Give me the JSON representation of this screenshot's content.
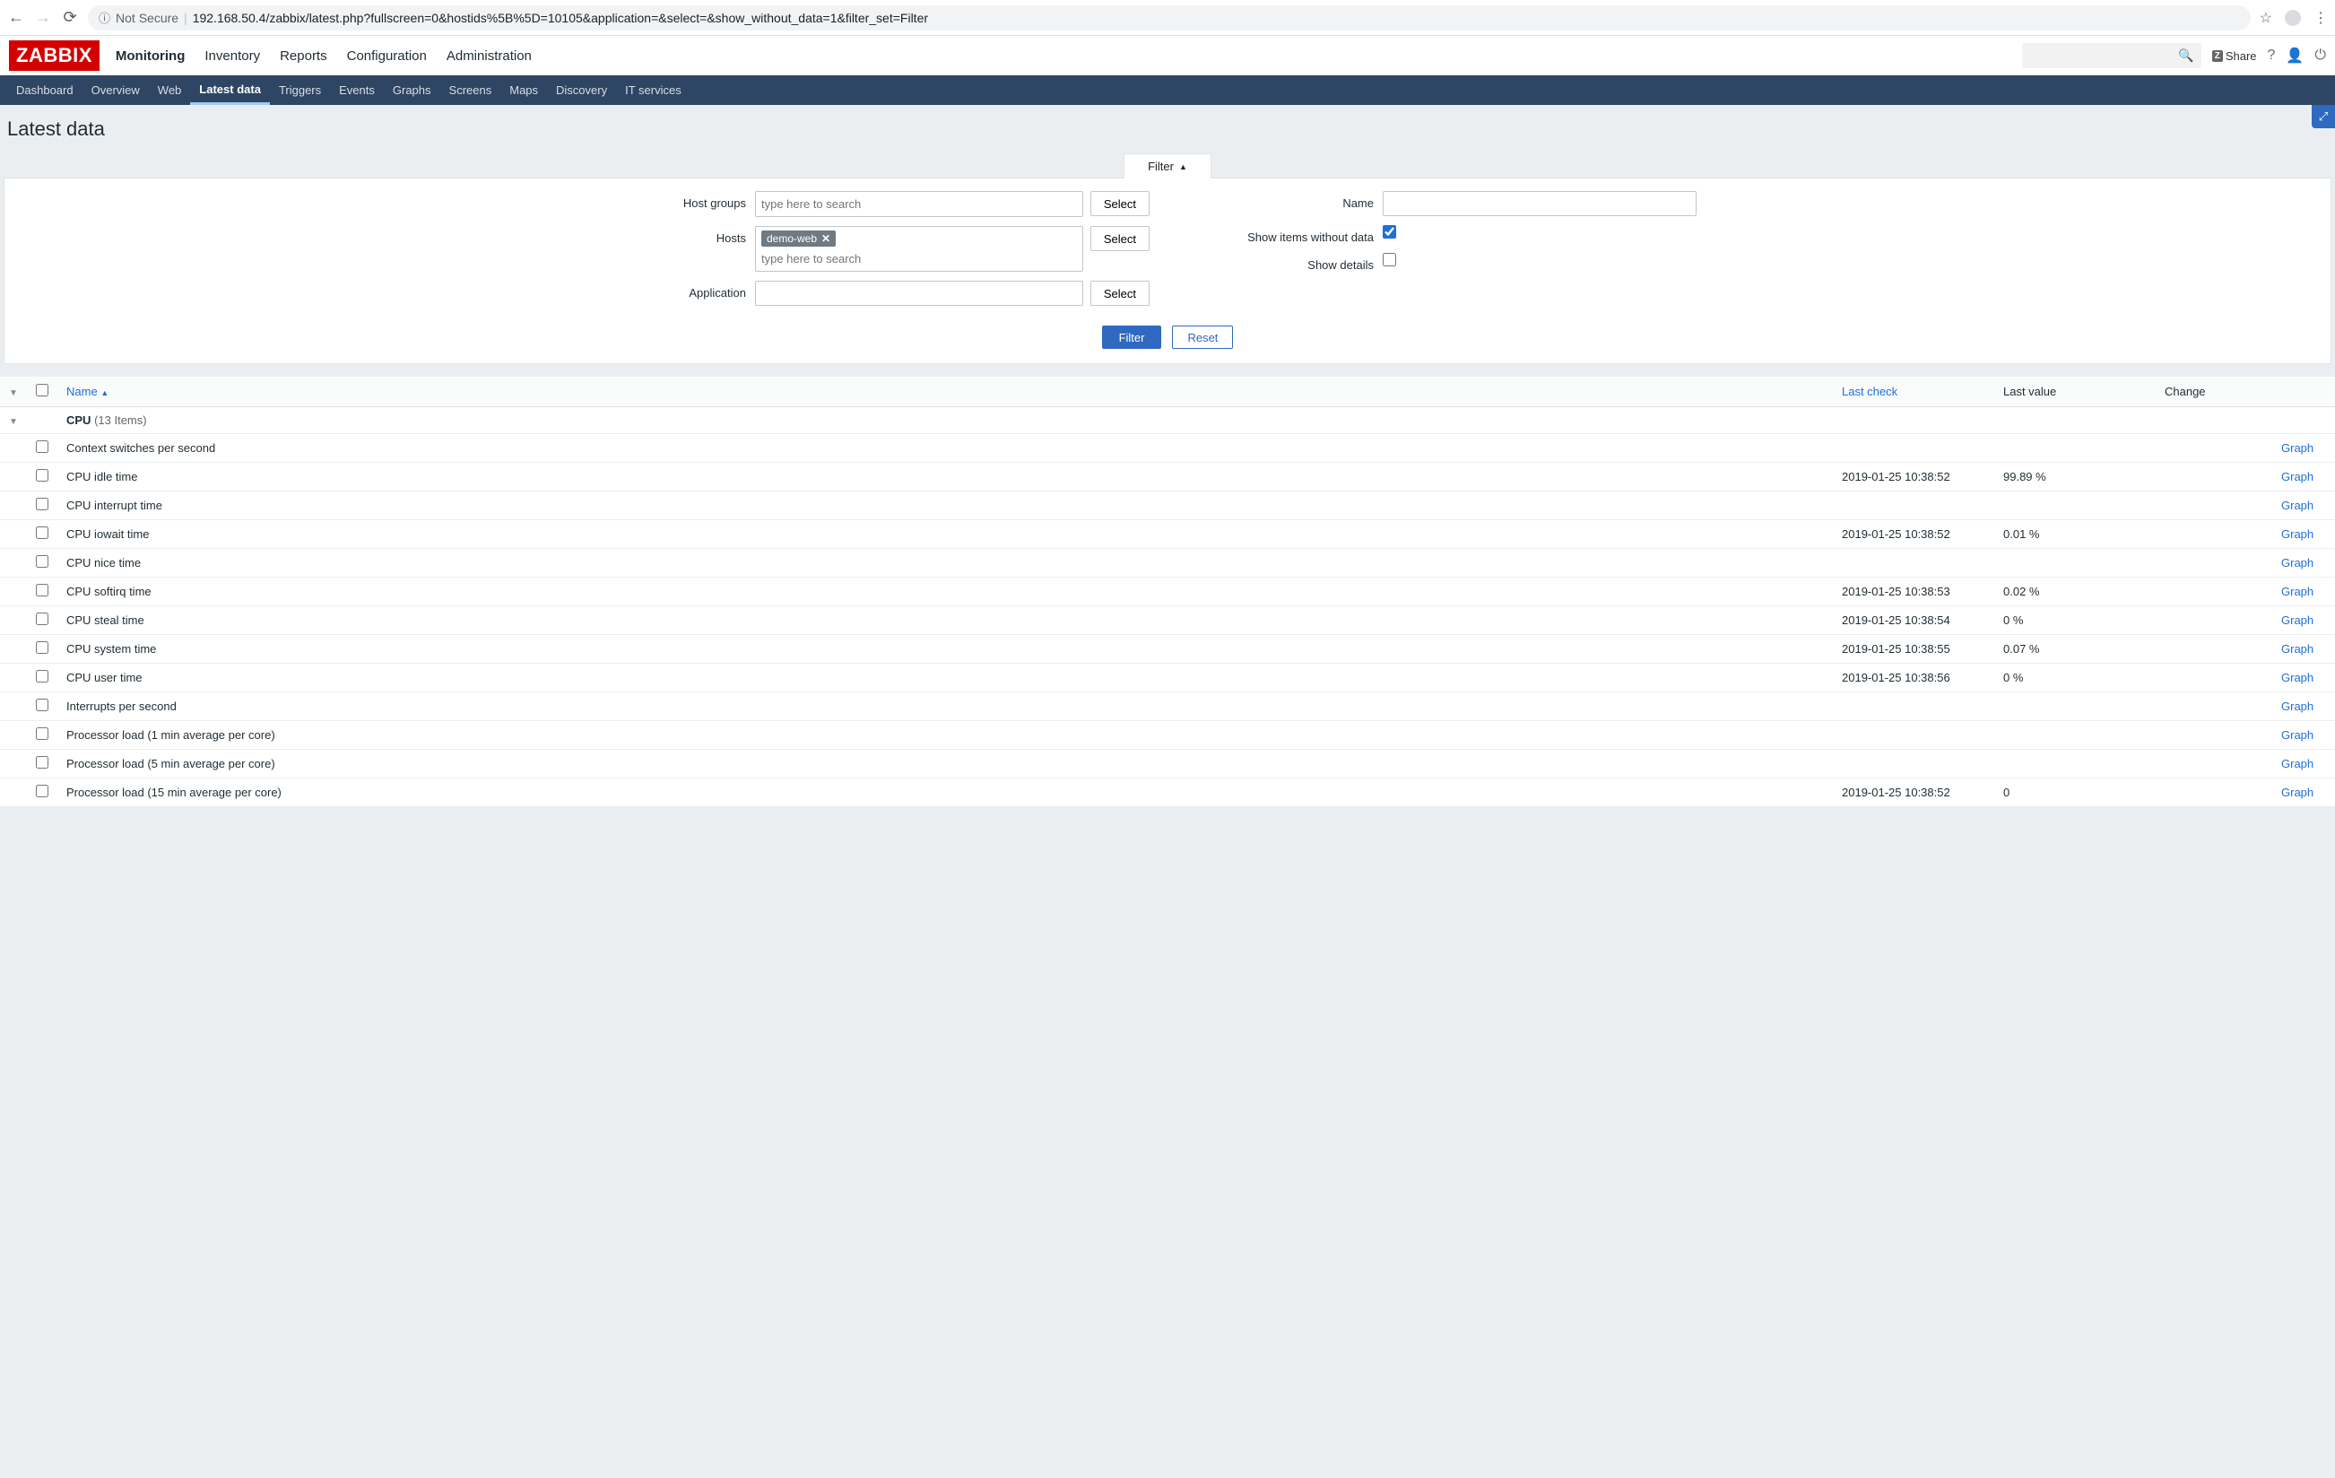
{
  "browser": {
    "not_secure": "Not Secure",
    "url": "192.168.50.4/zabbix/latest.php?fullscreen=0&hostids%5B%5D=10105&application=&select=&show_without_data=1&filter_set=Filter"
  },
  "brand": {
    "logo_text": "ZABBIX",
    "share_label": "Share"
  },
  "main_nav": [
    "Monitoring",
    "Inventory",
    "Reports",
    "Configuration",
    "Administration"
  ],
  "main_nav_active": 0,
  "sub_nav": [
    "Dashboard",
    "Overview",
    "Web",
    "Latest data",
    "Triggers",
    "Events",
    "Graphs",
    "Screens",
    "Maps",
    "Discovery",
    "IT services"
  ],
  "sub_nav_active": 3,
  "page_title": "Latest data",
  "filter": {
    "tab_label": "Filter",
    "host_groups_label": "Host groups",
    "hosts_label": "Hosts",
    "application_label": "Application",
    "name_label": "Name",
    "show_items_without_data_label": "Show items without data",
    "show_details_label": "Show details",
    "select_label": "Select",
    "type_to_search_placeholder": "type here to search",
    "host_tags": [
      "demo-web"
    ],
    "filter_btn": "Filter",
    "reset_btn": "Reset",
    "show_items_without_data_checked": true,
    "show_details_checked": false
  },
  "table": {
    "headers": {
      "name": "Name",
      "last_check": "Last check",
      "last_value": "Last value",
      "change": "Change"
    },
    "group": {
      "name": "CPU",
      "count_label": "(13 Items)"
    },
    "action_label": "Graph",
    "rows": [
      {
        "name": "Context switches per second",
        "last_check": "",
        "last_value": "",
        "change": ""
      },
      {
        "name": "CPU idle time",
        "last_check": "2019-01-25 10:38:52",
        "last_value": "99.89 %",
        "change": ""
      },
      {
        "name": "CPU interrupt time",
        "last_check": "",
        "last_value": "",
        "change": ""
      },
      {
        "name": "CPU iowait time",
        "last_check": "2019-01-25 10:38:52",
        "last_value": "0.01 %",
        "change": ""
      },
      {
        "name": "CPU nice time",
        "last_check": "",
        "last_value": "",
        "change": ""
      },
      {
        "name": "CPU softirq time",
        "last_check": "2019-01-25 10:38:53",
        "last_value": "0.02 %",
        "change": ""
      },
      {
        "name": "CPU steal time",
        "last_check": "2019-01-25 10:38:54",
        "last_value": "0 %",
        "change": ""
      },
      {
        "name": "CPU system time",
        "last_check": "2019-01-25 10:38:55",
        "last_value": "0.07 %",
        "change": ""
      },
      {
        "name": "CPU user time",
        "last_check": "2019-01-25 10:38:56",
        "last_value": "0 %",
        "change": ""
      },
      {
        "name": "Interrupts per second",
        "last_check": "",
        "last_value": "",
        "change": ""
      },
      {
        "name": "Processor load (1 min average per core)",
        "last_check": "",
        "last_value": "",
        "change": ""
      },
      {
        "name": "Processor load (5 min average per core)",
        "last_check": "",
        "last_value": "",
        "change": ""
      },
      {
        "name": "Processor load (15 min average per core)",
        "last_check": "2019-01-25 10:38:52",
        "last_value": "0",
        "change": ""
      }
    ]
  }
}
